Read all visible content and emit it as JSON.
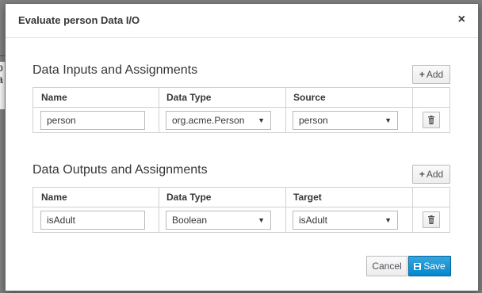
{
  "background": {
    "fragment_lines": [
      "o",
      "a"
    ]
  },
  "modal": {
    "title": "Evaluate person Data I/O",
    "close_glyph": "×"
  },
  "inputs": {
    "section_title": "Data Inputs and Assignments",
    "add_label": "Add",
    "columns": [
      "Name",
      "Data Type",
      "Source"
    ],
    "rows": [
      {
        "name": "person",
        "data_type": "org.acme.Person",
        "source": "person"
      }
    ]
  },
  "outputs": {
    "section_title": "Data Outputs and Assignments",
    "add_label": "Add",
    "columns": [
      "Name",
      "Data Type",
      "Target"
    ],
    "rows": [
      {
        "name": "isAdult",
        "data_type": "Boolean",
        "target": "isAdult"
      }
    ]
  },
  "footer": {
    "cancel_label": "Cancel",
    "save_label": "Save"
  },
  "colors": {
    "primary": "#0088ce",
    "border": "#d1d1d1",
    "overlay": "#7f7f7f"
  },
  "icons": {
    "add": "plus-icon",
    "delete": "trash-icon",
    "save": "floppy-icon",
    "dropdown": "caret-down-icon",
    "close": "close-icon"
  }
}
